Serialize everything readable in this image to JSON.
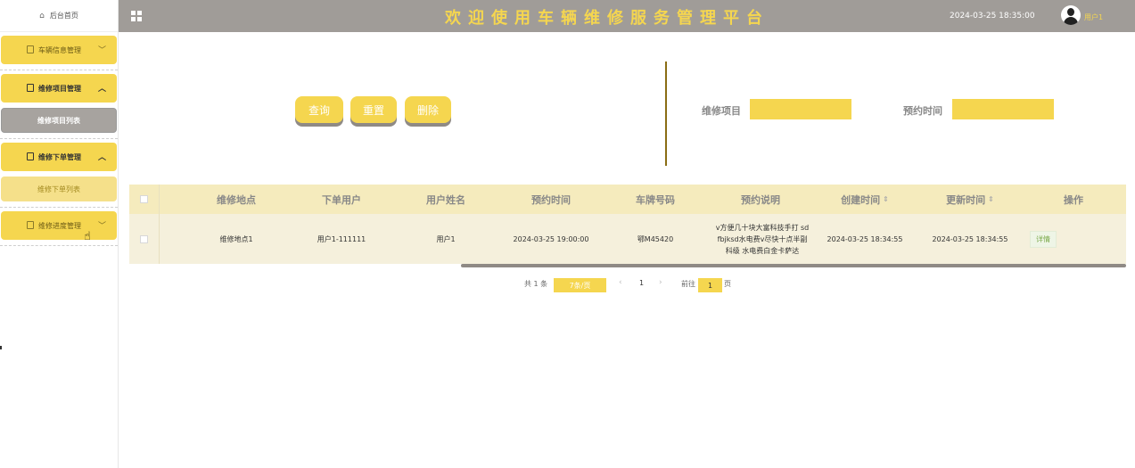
{
  "sidebar": {
    "home_label": "后台首页",
    "groups": [
      {
        "label": "车辆信息管理",
        "chevron": "﹀"
      },
      {
        "label": "维修项目管理",
        "chevron": "︿",
        "sub": "维修项目列表"
      },
      {
        "label": "维修下单管理",
        "chevron": "︿",
        "sub": "维修下单列表"
      },
      {
        "label": "维修进度管理",
        "chevron": "﹀"
      }
    ]
  },
  "header": {
    "title": "欢迎使用车辆维修服务管理平台",
    "datetime": "2024-03-25 18:35:00",
    "username": "用户1"
  },
  "actions": {
    "query": "查询",
    "reset": "重置",
    "delete": "删除"
  },
  "filters": {
    "item_label": "维修项目",
    "time_label": "预约时间"
  },
  "table": {
    "headers": [
      "维修地点",
      "下单用户",
      "用户姓名",
      "预约时间",
      "车牌号码",
      "预约说明",
      "创建时间",
      "更新时间",
      "操作"
    ],
    "rows": [
      {
        "location": "维修地点1",
        "order_user": "用户1-111111",
        "user_name": "用户1",
        "appt_time": "2024-03-25 19:00:00",
        "plate": "鄂M45420",
        "desc_lines": [
          "v方便几十块大富科技手打 sd",
          "fbjksd水电费v尽快十点半副",
          "科级 水电费白金卡萨达"
        ],
        "created": "2024-03-25 18:34:55",
        "updated": "2024-03-25 18:34:55",
        "detail": "详情"
      }
    ]
  },
  "pagination": {
    "total": "共 1 条",
    "page_size": "7条/页",
    "prev": "‹",
    "page": "1",
    "next": "›",
    "goto_prefix": "前往",
    "goto_value": "1",
    "goto_suffix": "页"
  },
  "icons": {
    "home": "home-icon",
    "grid": "grid-icon",
    "doc": "document-icon",
    "sort": "sort-icon",
    "cursor": "hand-cursor-icon"
  },
  "colors": {
    "accent": "#f5d64f",
    "header_bg": "#a09c98",
    "table_head": "#f5ebbd",
    "table_row": "#f5f0dc"
  }
}
